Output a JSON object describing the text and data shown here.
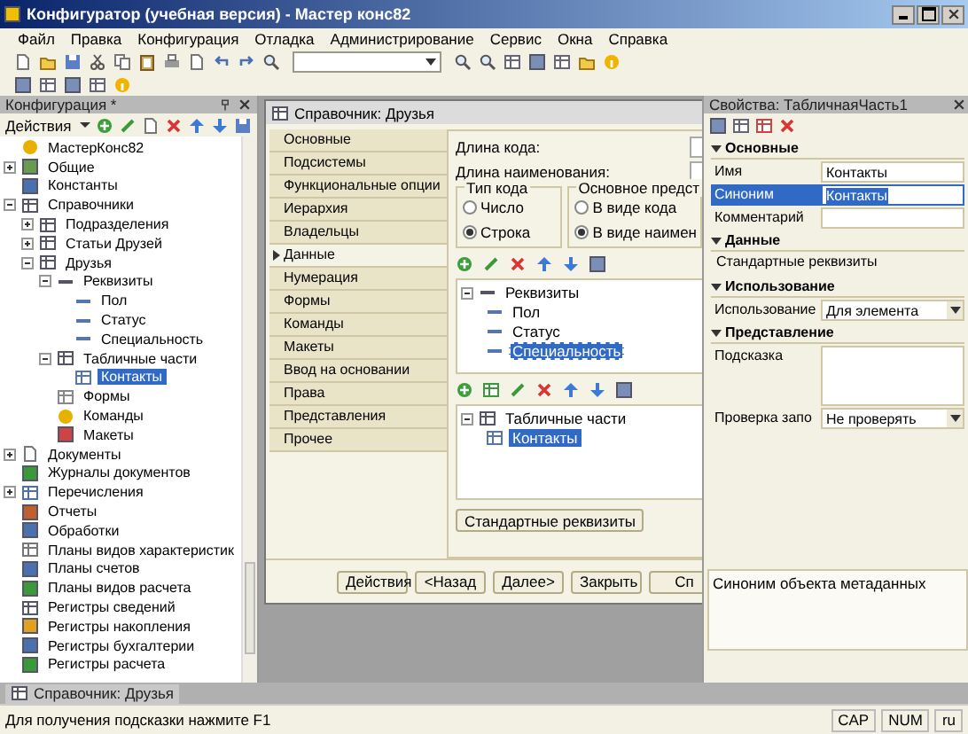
{
  "window": {
    "title": "Конфигуратор (учебная версия) - Мастер конс82"
  },
  "menu": [
    "Файл",
    "Правка",
    "Конфигурация",
    "Отладка",
    "Администрирование",
    "Сервис",
    "Окна",
    "Справка"
  ],
  "config_panel": {
    "title": "Конфигурация *",
    "actions_label": "Действия",
    "tree": [
      {
        "label": "МастерКонс82",
        "kind": "root",
        "selected": false
      },
      {
        "label": "Общие",
        "kind": "common",
        "expanded": false,
        "selected": false
      },
      {
        "label": "Константы",
        "kind": "constants",
        "selected": false
      },
      {
        "label": "Справочники",
        "kind": "catalogs",
        "expanded": true,
        "selected": false,
        "children": [
          {
            "label": "Подразделения",
            "kind": "catalog",
            "expanded": false,
            "selected": false
          },
          {
            "label": "Статьи Друзей",
            "kind": "catalog",
            "expanded": false,
            "selected": false
          },
          {
            "label": "Друзья",
            "kind": "catalog",
            "expanded": true,
            "selected": false,
            "children": [
              {
                "label": "Реквизиты",
                "kind": "attrs",
                "expanded": true,
                "selected": false,
                "children": [
                  {
                    "label": "Пол",
                    "kind": "attr",
                    "selected": false
                  },
                  {
                    "label": "Статус",
                    "kind": "attr",
                    "selected": false
                  },
                  {
                    "label": "Специальность",
                    "kind": "attr",
                    "selected": false
                  }
                ]
              },
              {
                "label": "Табличные части",
                "kind": "tabs",
                "expanded": true,
                "selected": false,
                "children": [
                  {
                    "label": "Контакты",
                    "kind": "tab",
                    "selected": true
                  }
                ]
              },
              {
                "label": "Формы",
                "kind": "form",
                "selected": false
              },
              {
                "label": "Команды",
                "kind": "command",
                "selected": false
              },
              {
                "label": "Макеты",
                "kind": "template",
                "selected": false
              }
            ]
          }
        ]
      },
      {
        "label": "Документы",
        "kind": "document",
        "expanded": false,
        "selected": false
      },
      {
        "label": "Журналы документов",
        "kind": "journal",
        "selected": false
      },
      {
        "label": "Перечисления",
        "kind": "enum",
        "expanded": false,
        "selected": false
      },
      {
        "label": "Отчеты",
        "kind": "report",
        "selected": false
      },
      {
        "label": "Обработки",
        "kind": "processing",
        "selected": false
      },
      {
        "label": "Планы видов характеристик",
        "kind": "plan",
        "selected": false
      },
      {
        "label": "Планы счетов",
        "kind": "accounts",
        "selected": false
      },
      {
        "label": "Планы видов расчета",
        "kind": "calc",
        "selected": false
      },
      {
        "label": "Регистры сведений",
        "kind": "register",
        "selected": false
      },
      {
        "label": "Регистры накопления",
        "kind": "accum",
        "selected": false
      },
      {
        "label": "Регистры бухгалтерии",
        "kind": "accounts",
        "selected": false
      },
      {
        "label": "Регистры расчета",
        "kind": "calcreg",
        "selected": false
      }
    ]
  },
  "editor": {
    "title": "Справочник: Друзья",
    "tabs": [
      {
        "label": "Основные",
        "selected": false
      },
      {
        "label": "Подсистемы",
        "selected": false
      },
      {
        "label": "Функциональные опции",
        "selected": false
      },
      {
        "label": "Иерархия",
        "selected": false
      },
      {
        "label": "Владельцы",
        "selected": false
      },
      {
        "label": "Данные",
        "selected": true
      },
      {
        "label": "Нумерация",
        "selected": false
      },
      {
        "label": "Формы",
        "selected": false
      },
      {
        "label": "Команды",
        "selected": false
      },
      {
        "label": "Макеты",
        "selected": false
      },
      {
        "label": "Ввод на основании",
        "selected": false
      },
      {
        "label": "Права",
        "selected": false
      },
      {
        "label": "Представления",
        "selected": false
      },
      {
        "label": "Прочее",
        "selected": false
      }
    ],
    "code_length_label": "Длина кода:",
    "name_length_label": "Длина наименования:",
    "groups": [
      {
        "title": "Тип кода",
        "options": [
          {
            "label": "Число",
            "selected": false
          },
          {
            "label": "Строка",
            "selected": true
          }
        ]
      },
      {
        "title": "Основное предст",
        "options": [
          {
            "label": "В виде кода",
            "selected": false
          },
          {
            "label": "В виде наимен",
            "selected": true
          }
        ]
      }
    ],
    "attributes_tree": [
      {
        "label": "Реквизиты",
        "kind": "attrs",
        "expanded": true,
        "selected": false,
        "children": [
          {
            "label": "Пол",
            "kind": "attr",
            "selected": false
          },
          {
            "label": "Статус",
            "kind": "attr",
            "selected": false
          },
          {
            "label": "Специальность",
            "kind": "attr",
            "selected": true
          }
        ]
      }
    ],
    "tabular_tree": [
      {
        "label": "Табличные части",
        "kind": "tabs",
        "expanded": true,
        "selected": false,
        "children": [
          {
            "label": "Контакты",
            "kind": "tab",
            "selected": true
          }
        ]
      }
    ],
    "standard_attributes_button": "Стандартные реквизиты",
    "buttons": [
      {
        "label": "Действия",
        "kind": "menu"
      },
      {
        "label": "<Назад",
        "kind": "plain"
      },
      {
        "label": "Далее>",
        "kind": "plain"
      },
      {
        "label": "Закрыть",
        "kind": "plain"
      },
      {
        "label": "Сп",
        "kind": "plain"
      }
    ]
  },
  "properties": {
    "title": "Свойства: ТабличнаяЧасть1",
    "sections": [
      {
        "title": "Основные",
        "expanded": true,
        "rows": [
          {
            "label": "Имя",
            "value": "Контакты",
            "kind": "text",
            "selected": false
          },
          {
            "label": "Синоним",
            "value": "Контакты",
            "kind": "text",
            "selected": true
          },
          {
            "label": "Комментарий",
            "value": "",
            "kind": "text",
            "selected": false
          }
        ]
      },
      {
        "title": "Данные",
        "expanded": true,
        "rows": [
          {
            "value": "Стандартные реквизиты",
            "kind": "link",
            "selected": false
          }
        ]
      },
      {
        "title": "Использование",
        "expanded": true,
        "rows": [
          {
            "label": "Использование",
            "value": "Для элемента",
            "kind": "select",
            "selected": false
          }
        ]
      },
      {
        "title": "Представление",
        "expanded": true,
        "rows": [
          {
            "label": "Подсказка",
            "value": "",
            "kind": "textarea",
            "selected": false
          },
          {
            "label": "Проверка запо",
            "value": "Не проверять",
            "kind": "select",
            "selected": false
          }
        ]
      }
    ],
    "description": "Синоним объекта метаданных"
  },
  "taskbar": [
    {
      "label": "Справочник: Друзья",
      "selected": true
    }
  ],
  "status_bar": {
    "hint": "Для получения подсказки нажмите F1",
    "indicators": [
      "CAP",
      "NUM",
      "ru"
    ]
  }
}
